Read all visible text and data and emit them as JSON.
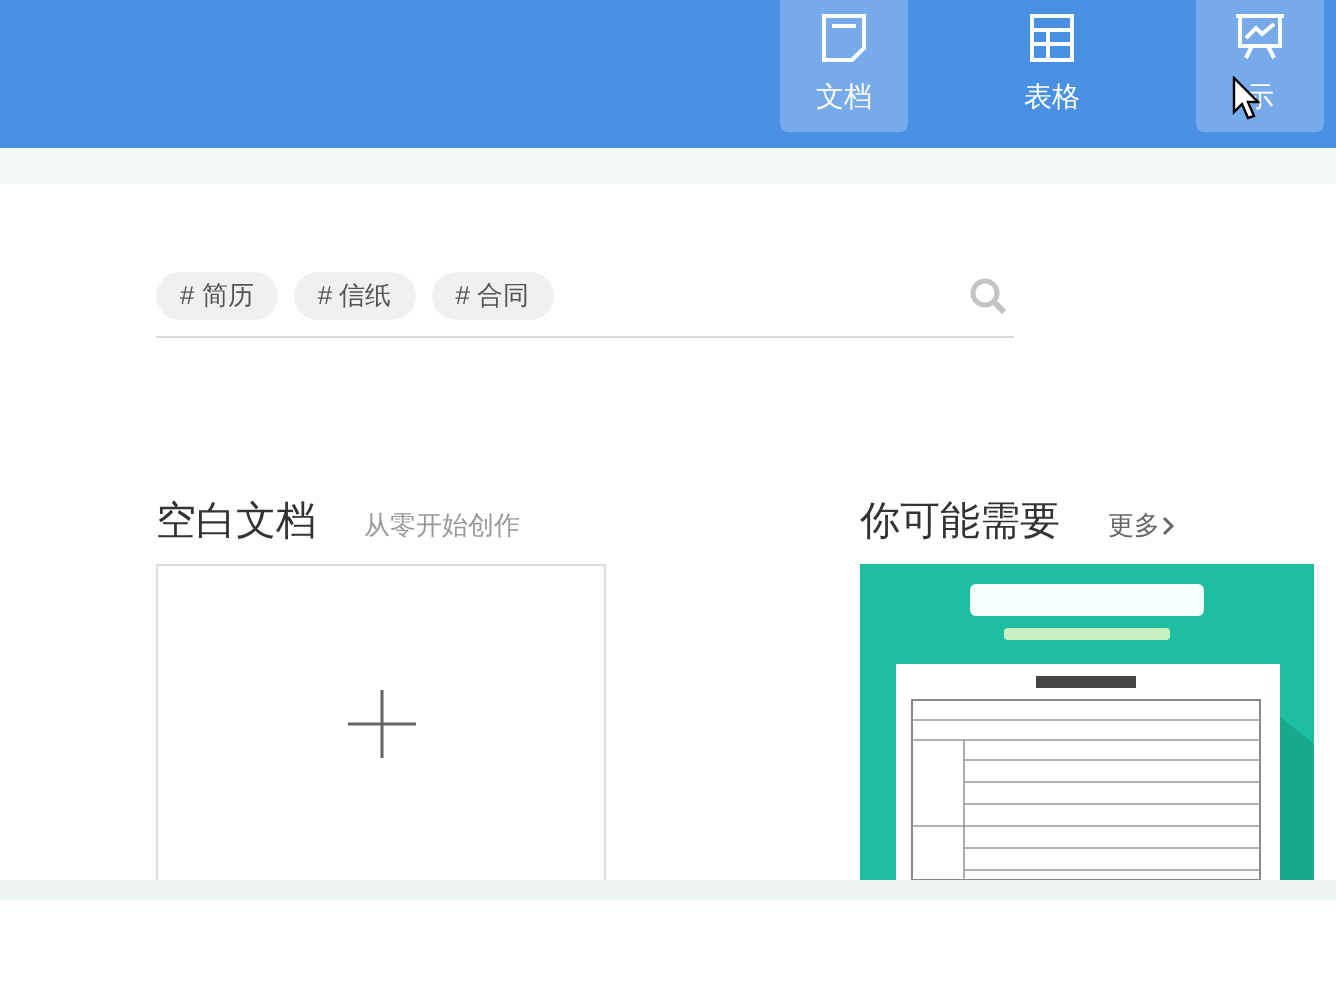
{
  "tabs": [
    {
      "label": "文档",
      "kind": "document",
      "highlighted": true
    },
    {
      "label": "表格",
      "kind": "table",
      "highlighted": false
    },
    {
      "label": "示",
      "kind": "presentation",
      "highlighted": true
    }
  ],
  "search": {
    "tags": [
      "# 简历",
      "# 信纸",
      "# 合同"
    ]
  },
  "blank": {
    "title": "空白文档",
    "subtitle": "从零开始创作"
  },
  "suggest": {
    "title": "你可能需要",
    "more": "更多"
  }
}
